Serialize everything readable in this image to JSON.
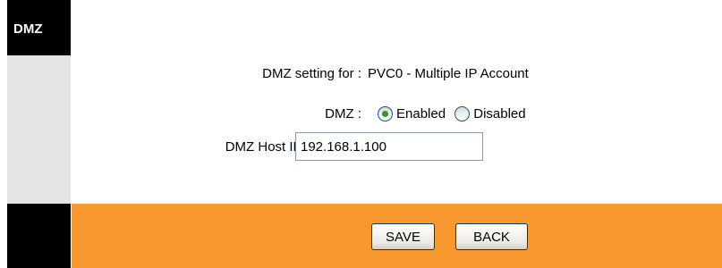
{
  "sidebar": {
    "title": "DMZ"
  },
  "form": {
    "setting_label": "DMZ setting for :",
    "setting_value": "PVC0 - Multiple IP Account",
    "dmz_label": "DMZ :",
    "enabled_label": "Enabled",
    "disabled_label": "Disabled",
    "dmz_selected": "Enabled",
    "host_ip_label": "DMZ Host IP Address :",
    "host_ip_value": "192.168.1.100"
  },
  "footer": {
    "save_label": "SAVE",
    "back_label": "BACK"
  },
  "colors": {
    "footer_bg": "#f7992e",
    "sidebar_bg": "#e4e4e4",
    "sidebar_title_bg": "#000000"
  }
}
